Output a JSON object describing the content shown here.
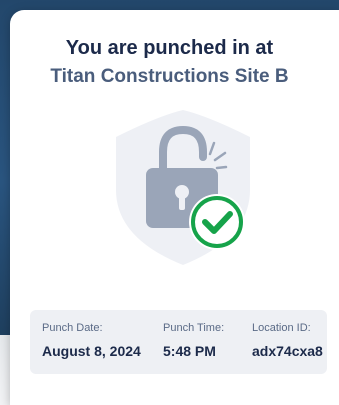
{
  "header": {
    "title": "You are punched in at",
    "site": "Titan Constructions Site B"
  },
  "illustration": {
    "icons": [
      "shield-icon",
      "padlock-unlocked-icon",
      "checkmark-circle-icon"
    ],
    "accent_color": "#16a34a"
  },
  "details": {
    "date_label": "Punch Date:",
    "date_value": "August 8, 2024",
    "time_label": "Punch Time:",
    "time_value": "5:48 PM",
    "location_label": "Location ID:",
    "location_value": "adx74cxa8"
  }
}
